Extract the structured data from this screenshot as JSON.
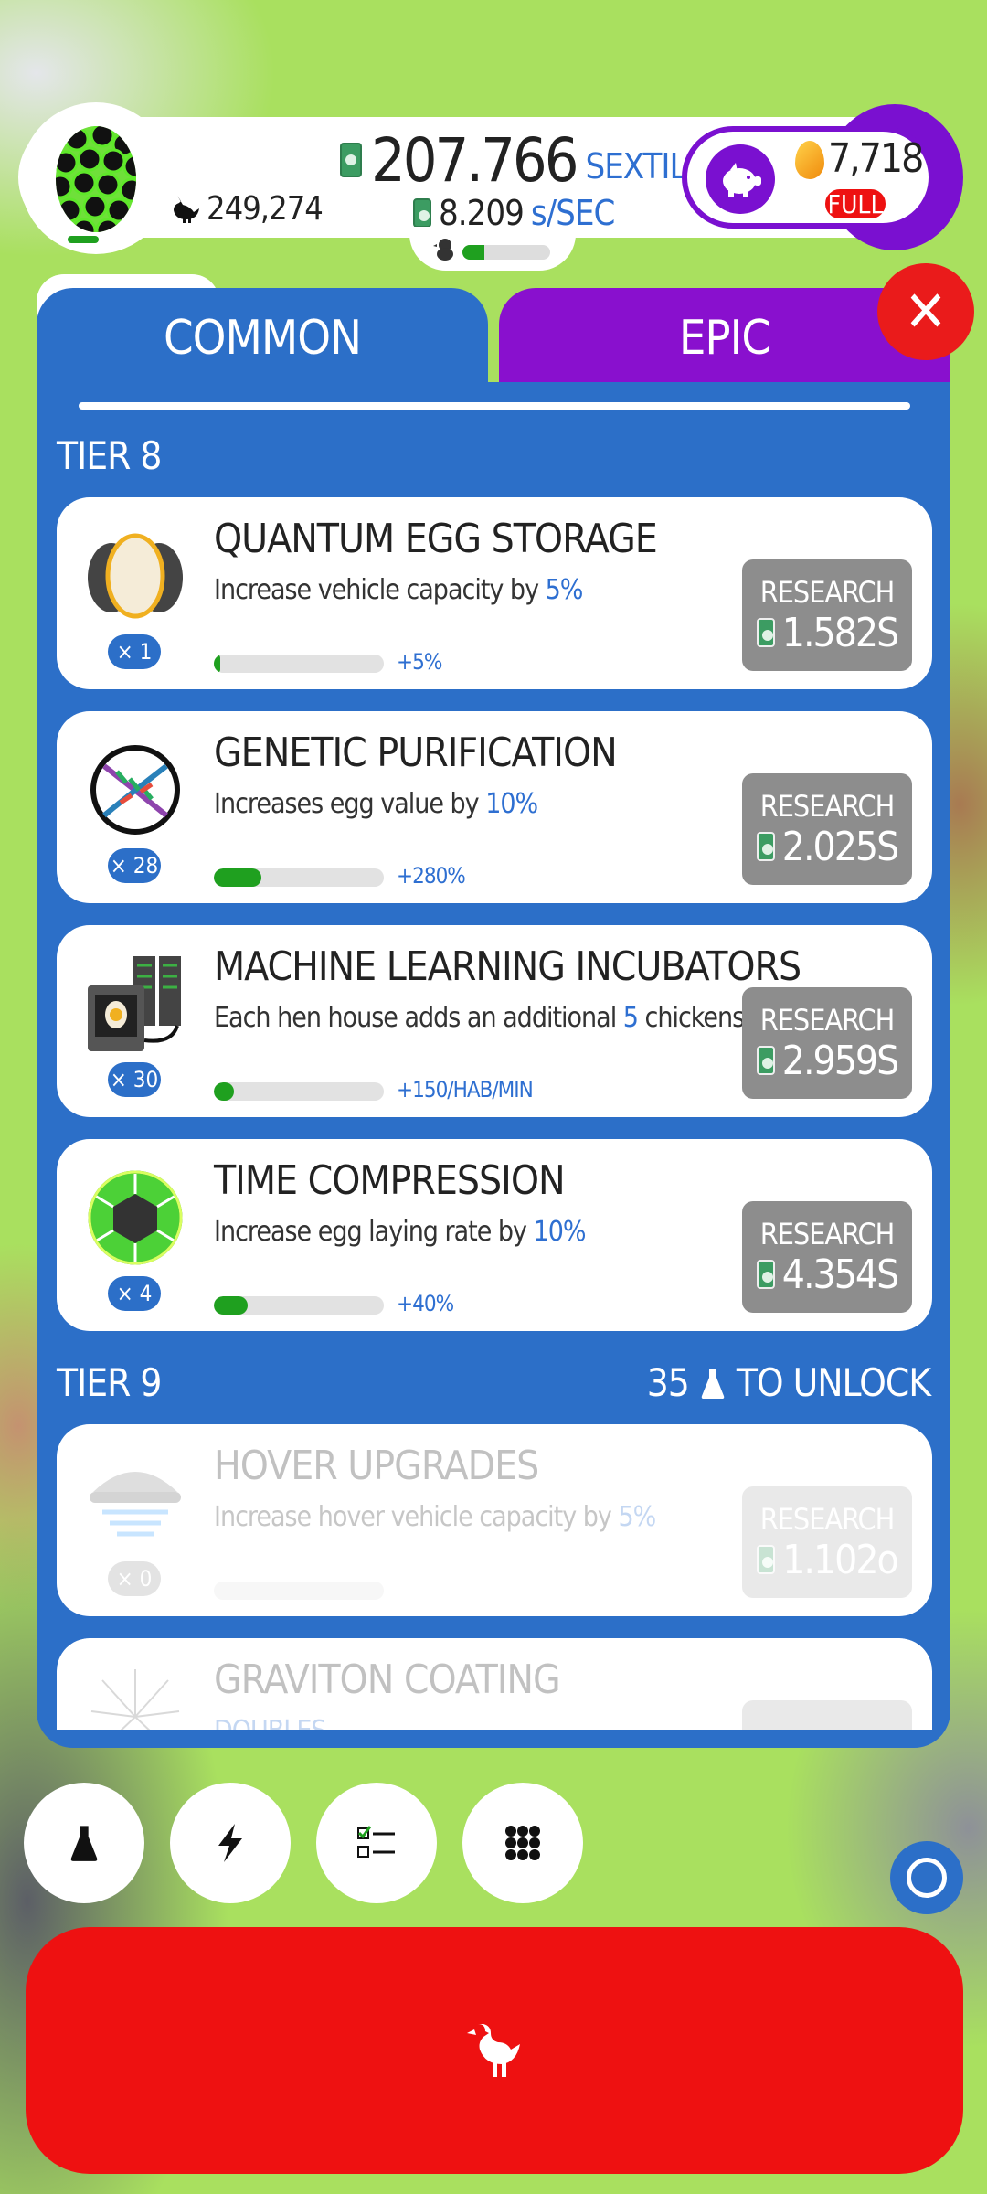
{
  "hud": {
    "chicken_count": "249,274",
    "money_value": "207.766",
    "money_unit": "SEXTILLION",
    "rate_value": "8.209",
    "rate_unit": "s/SEC",
    "golden_eggs": "7,718",
    "piggy_status": "FULL",
    "hatchery_fill": 0.25
  },
  "tabs": {
    "common": "COMMON",
    "epic": "EPIC"
  },
  "tier8": {
    "label": "TIER 8"
  },
  "tier9": {
    "label": "TIER 9",
    "unlock_count": "35",
    "unlock_text": "TO UNLOCK"
  },
  "research_label": "RESEARCH",
  "cards": [
    {
      "title": "QUANTUM EGG STORAGE",
      "desc_pre": "Increase vehicle capacity by ",
      "desc_hl": "5%",
      "desc_post": "",
      "mult": "× 1",
      "bonus": "+5%",
      "price": "1.582S",
      "progress": 0.04
    },
    {
      "title": "GENETIC PURIFICATION",
      "desc_pre": "Increases egg value by ",
      "desc_hl": "10%",
      "desc_post": "",
      "mult": "× 28",
      "bonus": "+280%",
      "price": "2.025S",
      "progress": 0.28
    },
    {
      "title": "MACHINE LEARNING INCUBATORS",
      "desc_pre": "Each hen house adds an additional ",
      "desc_hl": "5",
      "desc_post": " chickens/min",
      "mult": "× 30",
      "bonus": "+150/HAB/MIN",
      "price": "2.959S",
      "progress": 0.12
    },
    {
      "title": "TIME COMPRESSION",
      "desc_pre": "Increase egg laying rate by ",
      "desc_hl": "10%",
      "desc_post": "",
      "mult": "× 4",
      "bonus": "+40%",
      "price": "4.354S",
      "progress": 0.2
    },
    {
      "title": "HOVER UPGRADES",
      "desc_pre": "Increase hover vehicle capacity by ",
      "desc_hl": "5%",
      "desc_post": "",
      "mult": "× 0",
      "bonus": "",
      "price": "1.102o",
      "progress": 0
    },
    {
      "title": "GRAVITON COATING",
      "desc_pre": "DOUBLES",
      "desc_hl": "",
      "desc_post": "",
      "mult": "",
      "bonus": "",
      "price": "",
      "progress": 0
    }
  ],
  "colors": {
    "panel": "#2c6fc8",
    "epic": "#8910ce",
    "red": "#ee1111",
    "green": "#1fa01f",
    "grass": "#a9e05f"
  }
}
